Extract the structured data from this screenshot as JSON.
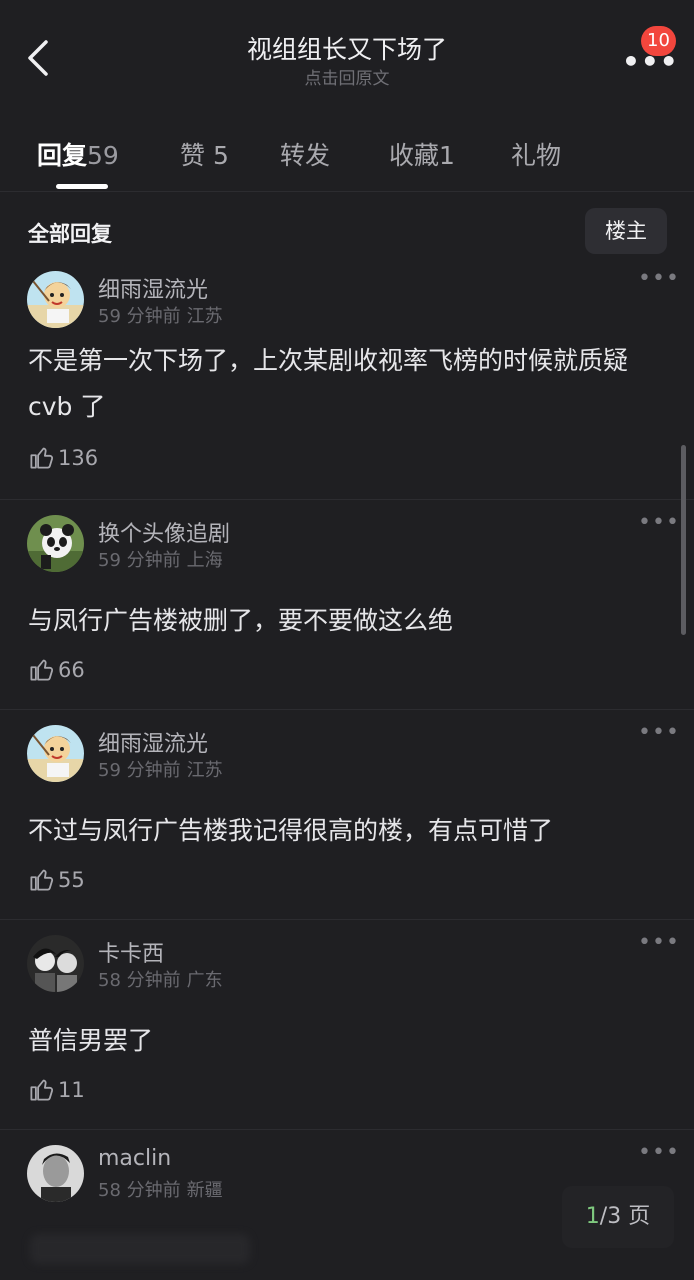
{
  "header": {
    "back_icon": "back-chevron-icon",
    "title": "视组组长又下场了",
    "subtitle": "点击回原文",
    "more_icon": "more-dots-icon",
    "badge_count": "10",
    "badge_color": "#f2463d"
  },
  "tabs": [
    {
      "label": "回复",
      "count": "59",
      "active": true
    },
    {
      "label": "赞",
      "count": "5",
      "active": false
    },
    {
      "label": "转发",
      "count": "",
      "active": false
    },
    {
      "label": "收藏",
      "count": "1",
      "active": false
    },
    {
      "label": "礼物",
      "count": "",
      "active": false
    }
  ],
  "section": {
    "title": "全部回复",
    "filter_label": "楼主"
  },
  "comments": [
    {
      "username": "细雨湿流光",
      "time": "59 分钟前",
      "location": "江苏",
      "content": "不是第一次下场了，上次某剧收视率飞榜的时候就质疑 cvb 了",
      "likes": "136",
      "avatar": "cartoon-avatar"
    },
    {
      "username": "换个头像追剧",
      "time": "59 分钟前",
      "location": "上海",
      "content": "与凤行广告楼被删了，要不要做这么绝",
      "likes": "66",
      "avatar": "panda-avatar"
    },
    {
      "username": "细雨湿流光",
      "time": "59 分钟前",
      "location": "江苏",
      "content": "不过与凤行广告楼我记得很高的楼，有点可惜了",
      "likes": "55",
      "avatar": "cartoon-avatar"
    },
    {
      "username": "卡卡西",
      "time": "58 分钟前",
      "location": "广东",
      "content": "普信男罢了",
      "likes": "11",
      "avatar": "anime-avatar"
    },
    {
      "username": "maclin",
      "time": "58 分钟前",
      "location": "新疆",
      "content": "",
      "likes": "",
      "avatar": "photo-avatar"
    }
  ],
  "pager": {
    "current": "1",
    "total_text": "/3 页",
    "current_color": "#7fc97f"
  },
  "colors": {
    "background": "#1f1f22",
    "divider": "#2c2c30"
  }
}
